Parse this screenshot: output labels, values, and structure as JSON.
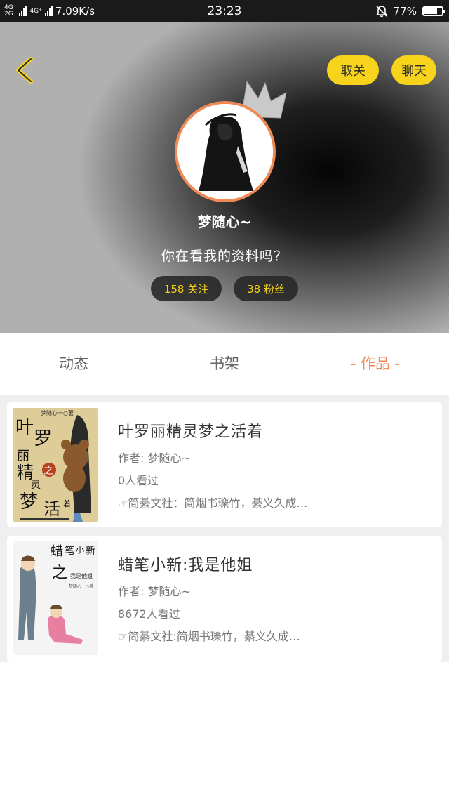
{
  "status_bar": {
    "network": [
      "4G⁺",
      "4G⁺",
      "2G"
    ],
    "speed": "7.09K/s",
    "time": "23:23",
    "battery": "77%",
    "battery_level": 0.77
  },
  "header": {
    "unfollow_label": "取关",
    "chat_label": "聊天",
    "username": "梦随心~",
    "bio": "你在看我的资料吗？",
    "following": "158 关注",
    "fans": "38 粉丝",
    "accent_color": "#f7d31b",
    "avatar_ring_color": "#f08a54"
  },
  "tabs": [
    {
      "label": "动态"
    },
    {
      "label": "书架"
    },
    {
      "label": "- 作品 -",
      "active": true
    }
  ],
  "works": [
    {
      "title": "叶罗丽精灵梦之活着",
      "author": "作者: 梦随心~",
      "views": "0人看过",
      "community": "☞简綦文社：简烟书瓅竹，綦义久成…",
      "cover": {
        "byline": "梦随心一○著",
        "chars": [
          "叶",
          "罗",
          "丽",
          "精",
          "之",
          "灵",
          "梦",
          "活",
          "着"
        ]
      }
    },
    {
      "title": "蜡笔小新:我是他姐",
      "author": "作者: 梦随心~",
      "views": "8672人看过",
      "community": "☞简綦文社:简烟书瓅竹，綦义久成…",
      "cover": {
        "title_chars": [
          "蜡",
          "笔",
          "小",
          "新"
        ],
        "zhi": "之",
        "subtitle": "我是他姐",
        "byline": "梦随心一○著"
      }
    }
  ]
}
